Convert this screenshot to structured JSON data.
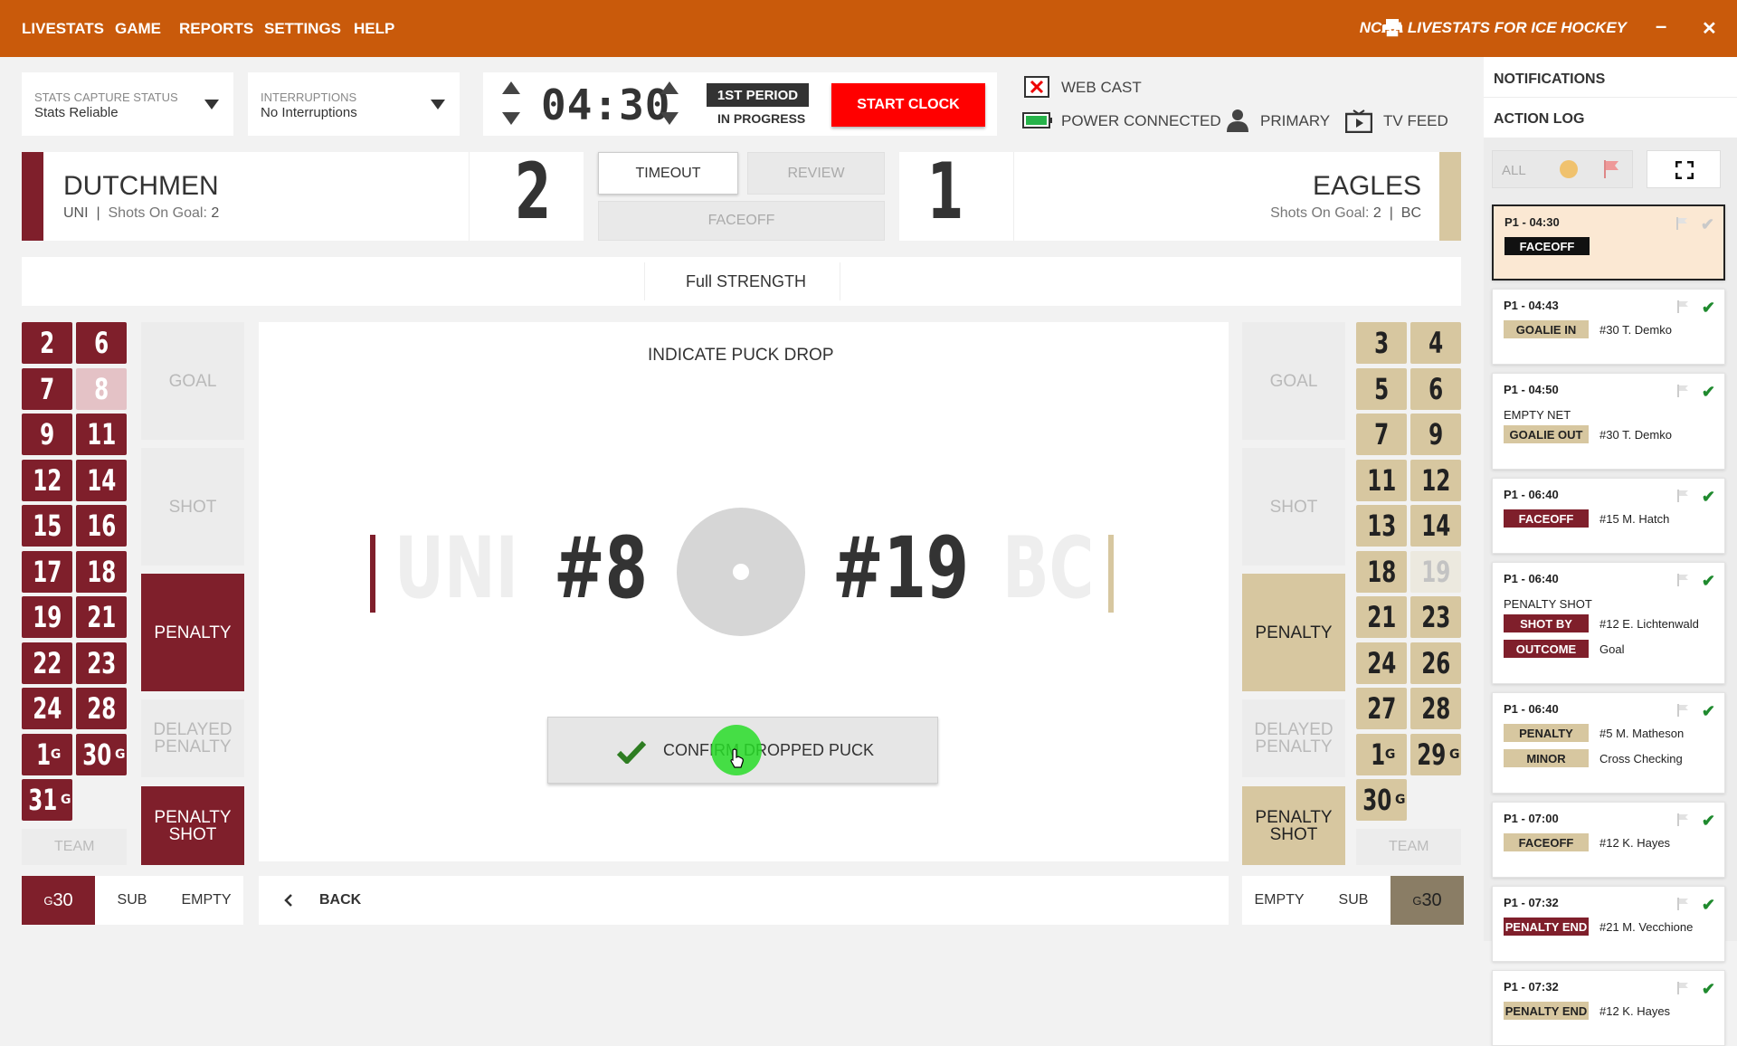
{
  "topbar": {
    "menu": [
      "LIVESTATS",
      "GAME",
      "REPORTS",
      "SETTINGS",
      "HELP"
    ],
    "title": "NCAA LIVESTATS FOR ICE HOCKEY",
    "minimize": "–",
    "close": "✕"
  },
  "capture": {
    "label": "STATS CAPTURE STATUS",
    "value": "Stats Reliable"
  },
  "interruptions": {
    "label": "INTERRUPTIONS",
    "value": "No Interruptions"
  },
  "clock": {
    "time": "04:30",
    "period": "1ST PERIOD",
    "status": "IN PROGRESS",
    "start": "START CLOCK"
  },
  "status": {
    "webcast": "WEB CAST",
    "power": "POWER CONNECTED",
    "primary": "PRIMARY",
    "tvfeed": "TV FEED"
  },
  "home": {
    "name": "DUTCHMEN",
    "abbr": "UNI",
    "sog_label": "Shots On Goal:",
    "sog": "2",
    "score": "2",
    "color": "#7f1f2b"
  },
  "away": {
    "name": "EAGLES",
    "abbr": "BC",
    "sog_label": "Shots On Goal:",
    "sog": "2",
    "score": "1",
    "color": "#d7c7a0"
  },
  "center_buttons": {
    "timeout": "TIMEOUT",
    "review": "REVIEW",
    "faceoff": "FACEOFF"
  },
  "strength": "Full STRENGTH",
  "faceoff": {
    "prompt": "INDICATE PUCK DROP",
    "home_abbr": "UNI",
    "away_abbr": "BC",
    "home_player": "#8",
    "away_player": "#19",
    "confirm": "CONFIRM DROPPED PUCK"
  },
  "home_numbers": [
    {
      "n": "2",
      "g": ""
    },
    {
      "n": "6",
      "g": ""
    },
    {
      "n": "7",
      "g": ""
    },
    {
      "n": "8",
      "g": "",
      "dim": true
    },
    {
      "n": "9",
      "g": ""
    },
    {
      "n": "11",
      "g": ""
    },
    {
      "n": "12",
      "g": ""
    },
    {
      "n": "14",
      "g": ""
    },
    {
      "n": "15",
      "g": ""
    },
    {
      "n": "16",
      "g": ""
    },
    {
      "n": "17",
      "g": ""
    },
    {
      "n": "18",
      "g": ""
    },
    {
      "n": "19",
      "g": ""
    },
    {
      "n": "21",
      "g": ""
    },
    {
      "n": "22",
      "g": ""
    },
    {
      "n": "23",
      "g": ""
    },
    {
      "n": "24",
      "g": ""
    },
    {
      "n": "28",
      "g": ""
    },
    {
      "n": "1",
      "g": "G"
    },
    {
      "n": "30",
      "g": "G"
    },
    {
      "n": "31",
      "g": "G"
    }
  ],
  "away_numbers": [
    {
      "n": "3",
      "g": ""
    },
    {
      "n": "4",
      "g": ""
    },
    {
      "n": "5",
      "g": ""
    },
    {
      "n": "6",
      "g": ""
    },
    {
      "n": "7",
      "g": ""
    },
    {
      "n": "9",
      "g": ""
    },
    {
      "n": "11",
      "g": ""
    },
    {
      "n": "12",
      "g": ""
    },
    {
      "n": "13",
      "g": ""
    },
    {
      "n": "14",
      "g": ""
    },
    {
      "n": "18",
      "g": ""
    },
    {
      "n": "19",
      "g": "",
      "dim": true
    },
    {
      "n": "21",
      "g": ""
    },
    {
      "n": "23",
      "g": ""
    },
    {
      "n": "24",
      "g": ""
    },
    {
      "n": "26",
      "g": ""
    },
    {
      "n": "27",
      "g": ""
    },
    {
      "n": "28",
      "g": ""
    },
    {
      "n": "1",
      "g": "G"
    },
    {
      "n": "29",
      "g": "G"
    },
    {
      "n": "30",
      "g": "G"
    }
  ],
  "actions": {
    "goal": "GOAL",
    "shot": "SHOT",
    "penalty": "PENALTY",
    "delayed1": "DELAYED",
    "delayed2": "PENALTY",
    "pshot1": "PENALTY",
    "pshot2": "SHOT",
    "team": "TEAM"
  },
  "bottom": {
    "home_goalie_prefix": "G",
    "home_goalie": "30",
    "sub": "SUB",
    "empty": "EMPTY",
    "back": "BACK",
    "away_goalie_prefix": "G",
    "away_goalie": "30"
  },
  "sidebar": {
    "notifications": "NOTIFICATIONS",
    "action_log": "ACTION LOG",
    "filter_all": "ALL"
  },
  "log": [
    {
      "time": "P1 - 04:30",
      "lines": [],
      "tags": [
        {
          "t": "FACEOFF",
          "style": "black",
          "txt": ""
        }
      ],
      "checked": false,
      "active": true
    },
    {
      "time": "P1 - 04:43",
      "lines": [],
      "tags": [
        {
          "t": "GOALIE IN",
          "style": "tan",
          "txt": "#30 T. Demko"
        }
      ],
      "checked": true
    },
    {
      "time": "P1 - 04:50",
      "lines": [
        "EMPTY NET"
      ],
      "tags": [
        {
          "t": "GOALIE OUT",
          "style": "tan",
          "txt": "#30 T. Demko"
        }
      ],
      "checked": true
    },
    {
      "time": "P1 - 06:40",
      "lines": [],
      "tags": [
        {
          "t": "FACEOFF",
          "style": "red",
          "txt": "#15 M. Hatch"
        }
      ],
      "checked": true
    },
    {
      "time": "P1 - 06:40",
      "lines": [
        "PENALTY SHOT"
      ],
      "tags": [
        {
          "t": "SHOT BY",
          "style": "red",
          "txt": "#12 E. Lichtenwald"
        },
        {
          "t": "OUTCOME",
          "style": "red",
          "txt": "Goal"
        }
      ],
      "checked": true
    },
    {
      "time": "P1 - 06:40",
      "lines": [],
      "tags": [
        {
          "t": "PENALTY",
          "style": "tan",
          "txt": "#5 M. Matheson"
        },
        {
          "t": "MINOR",
          "style": "tan",
          "txt": "Cross Checking"
        }
      ],
      "checked": true
    },
    {
      "time": "P1 - 07:00",
      "lines": [],
      "tags": [
        {
          "t": "FACEOFF",
          "style": "tan",
          "txt": "#12 K. Hayes"
        }
      ],
      "checked": true
    },
    {
      "time": "P1 - 07:32",
      "lines": [],
      "tags": [
        {
          "t": "PENALTY END",
          "style": "red",
          "txt": "#21 M. Vecchione"
        }
      ],
      "checked": true
    },
    {
      "time": "P1 - 07:32",
      "lines": [],
      "tags": [
        {
          "t": "PENALTY END",
          "style": "tan",
          "txt": "#12 K. Hayes"
        }
      ],
      "checked": true
    }
  ]
}
